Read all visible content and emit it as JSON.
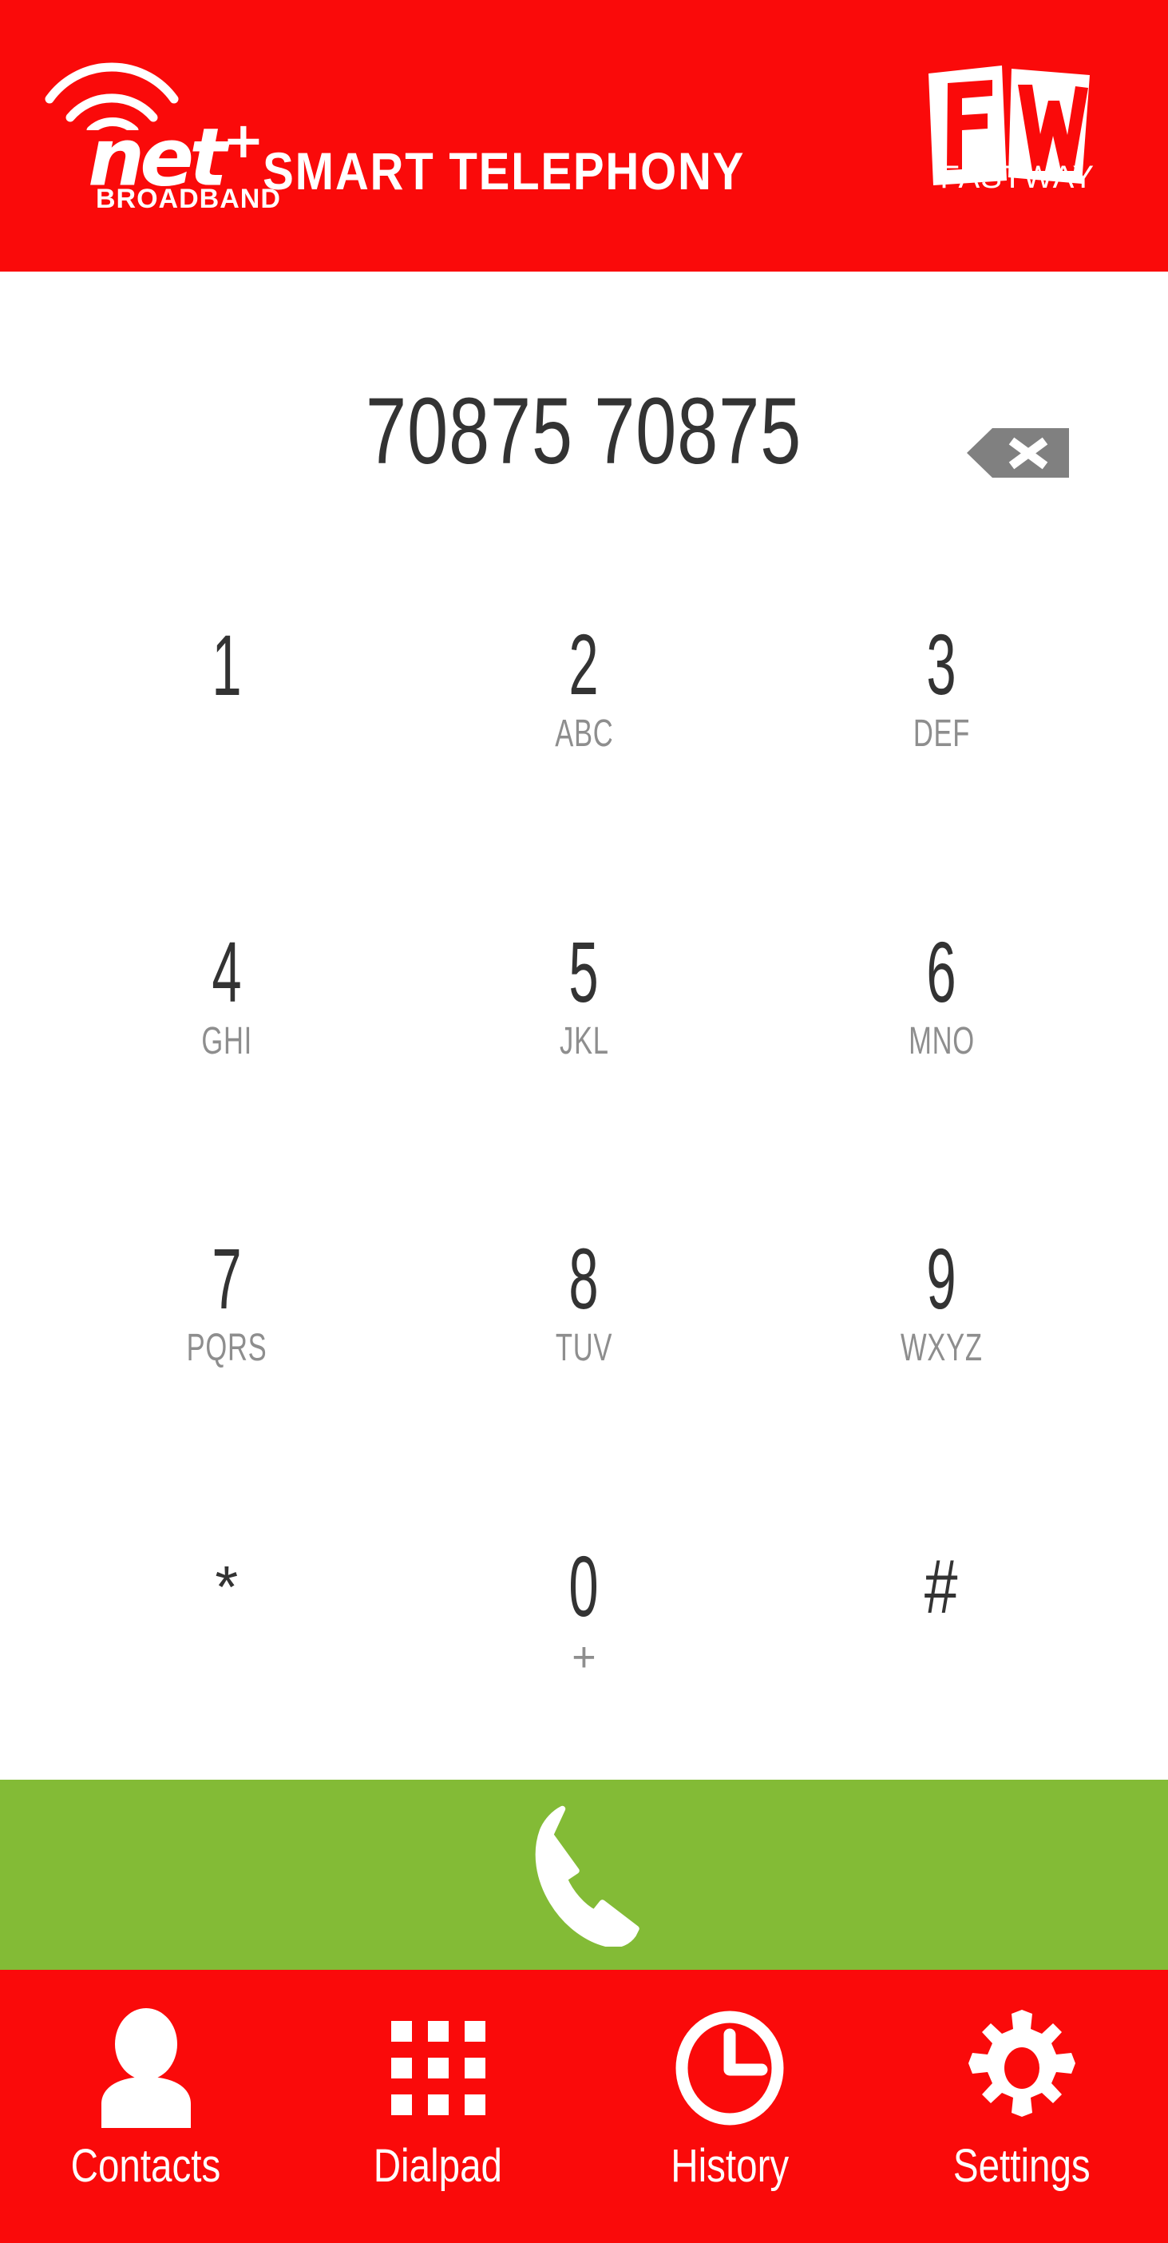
{
  "header": {
    "brand_name": "net",
    "brand_superscript": "+",
    "brand_subtitle": "BROADBAND",
    "title": "SMART TELEPHONY",
    "partner_logo_letters": "FW",
    "partner_name": "FASTWAY",
    "background_color": "#fa0a0a",
    "wifi_icon": "wifi-signal-icon"
  },
  "display": {
    "number": "70875 70875",
    "backspace_icon": "backspace-icon",
    "backspace_color": "#808080",
    "text_color": "#333333"
  },
  "keypad": {
    "keys": [
      {
        "digit": "1",
        "letters": ""
      },
      {
        "digit": "2",
        "letters": "ABC"
      },
      {
        "digit": "3",
        "letters": "DEF"
      },
      {
        "digit": "4",
        "letters": "GHI"
      },
      {
        "digit": "5",
        "letters": "JKL"
      },
      {
        "digit": "6",
        "letters": "MNO"
      },
      {
        "digit": "7",
        "letters": "PQRS"
      },
      {
        "digit": "8",
        "letters": "TUV"
      },
      {
        "digit": "9",
        "letters": "WXYZ"
      },
      {
        "digit": "*",
        "letters": ""
      },
      {
        "digit": "0",
        "letters": "+"
      },
      {
        "digit": "#",
        "letters": ""
      }
    ],
    "letters_color": "#8e8e8e"
  },
  "call_bar": {
    "icon": "phone-handset-icon",
    "background_color": "#83bb36"
  },
  "bottom_nav": {
    "background_color": "#fa0a0a",
    "items": [
      {
        "label": "Contacts",
        "icon": "person-icon"
      },
      {
        "label": "Dialpad",
        "icon": "grid-dots-icon"
      },
      {
        "label": "History",
        "icon": "clock-icon"
      },
      {
        "label": "Settings",
        "icon": "gear-icon"
      }
    ]
  }
}
